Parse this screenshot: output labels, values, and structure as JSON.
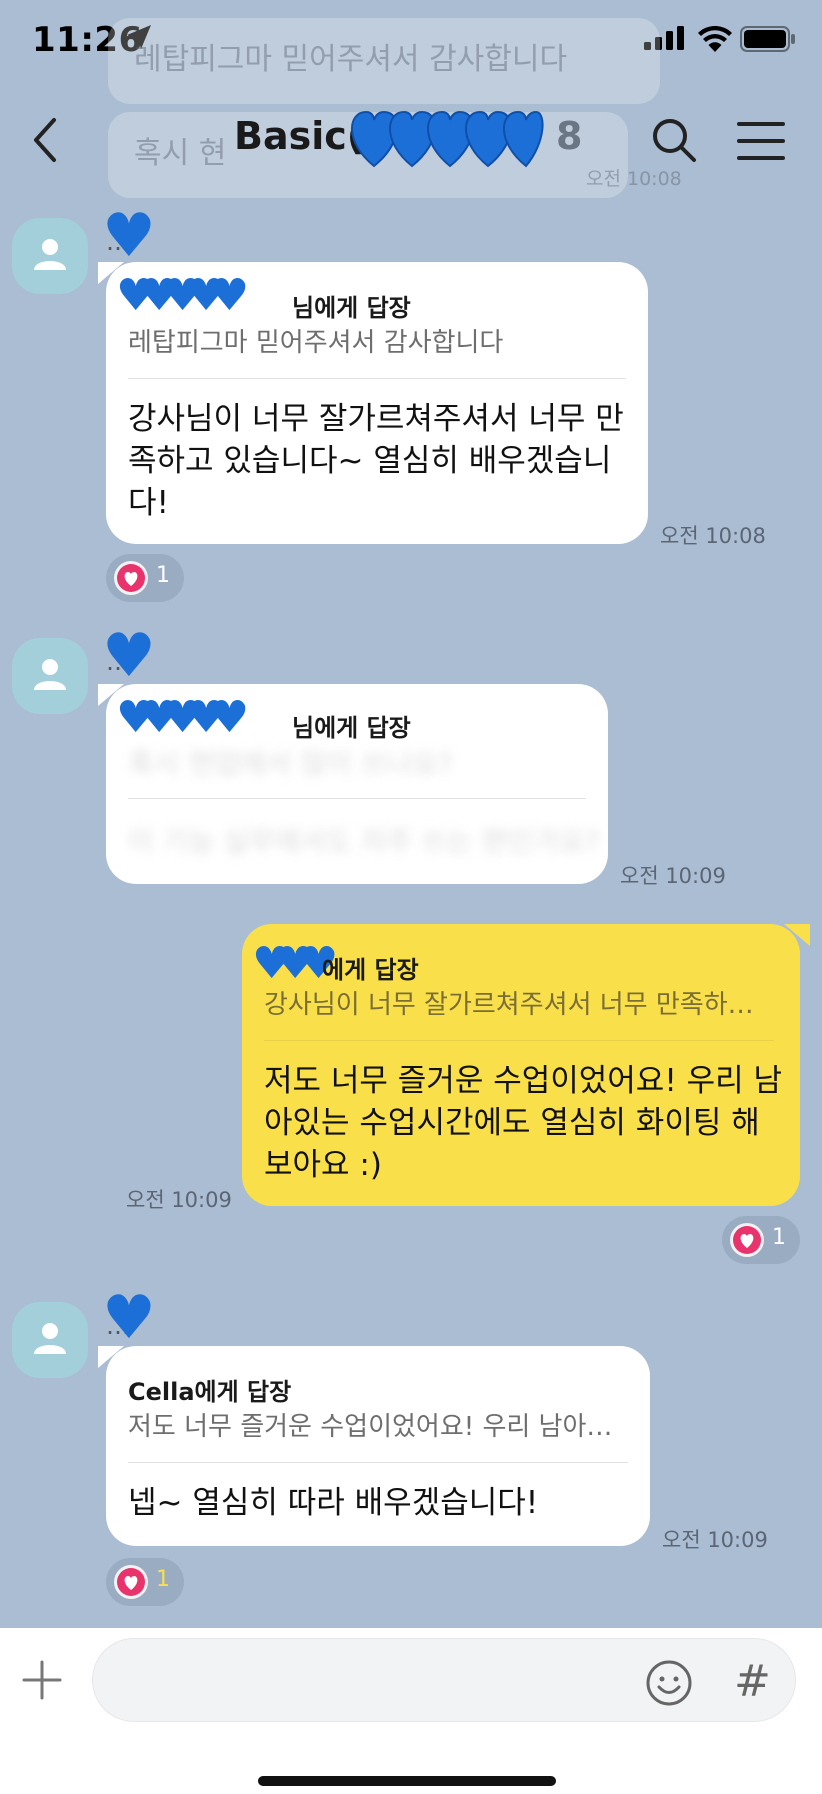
{
  "status_bar": {
    "time": "11:26"
  },
  "background_notices": [
    {
      "text": "레탑피그마 믿어주셔서 감사합니다"
    },
    {
      "text": "혹시 현"
    },
    {
      "time": "오전 10:08"
    }
  ],
  "header": {
    "title": "Basic(",
    "member_count": "8",
    "back_icon": "chevron-left-icon",
    "search_icon": "search-icon",
    "menu_icon": "hamburger-menu-icon"
  },
  "messages": [
    {
      "sender": "…",
      "reply_to": "님에게 답장",
      "quote": "레탑피그마 믿어주셔서 감사합니다",
      "text_lines": [
        "강사님이 너무 잘가르쳐주셔서 너무 만",
        "족하고 있습니다~ 열심히 배우겠습니",
        "다!"
      ],
      "time": "오전 10:08",
      "reaction_count": "1"
    },
    {
      "sender": "…",
      "reply_to": "님에게 답장",
      "quote": "혹시 현업에서 많이 쓰나요?",
      "text_lines": [
        "이 기능 실무에서도 자주 쓰는 편인가요?"
      ],
      "time": "오전 10:09"
    },
    {
      "sender": "me",
      "reply_to": "에게 답장",
      "quote": "강사님이 너무 잘가르쳐주셔서 너무 만족하…",
      "text_lines": [
        "저도 너무 즐거운 수업이었어요! 우리 남",
        "아있는 수업시간에도 열심히 화이팅 해",
        "보아요 :)"
      ],
      "time": "오전 10:09",
      "reaction_count": "1"
    },
    {
      "sender": "…",
      "reply_to": "Cella에게 답장",
      "quote": "저도 너무 즐거운 수업이었어요! 우리 남아…",
      "text_lines": [
        "넵~ 열심히 따라 배우겠습니다!"
      ],
      "time": "오전 10:09",
      "reaction_count": "1"
    }
  ],
  "input_bar": {
    "hash_label": "#"
  },
  "colors": {
    "background": "#abbdd2",
    "my_bubble": "#f9e04b",
    "other_bubble": "#ffffff",
    "heart_emoji": "#1d6fd8",
    "reaction_heart": "#e8336d"
  }
}
